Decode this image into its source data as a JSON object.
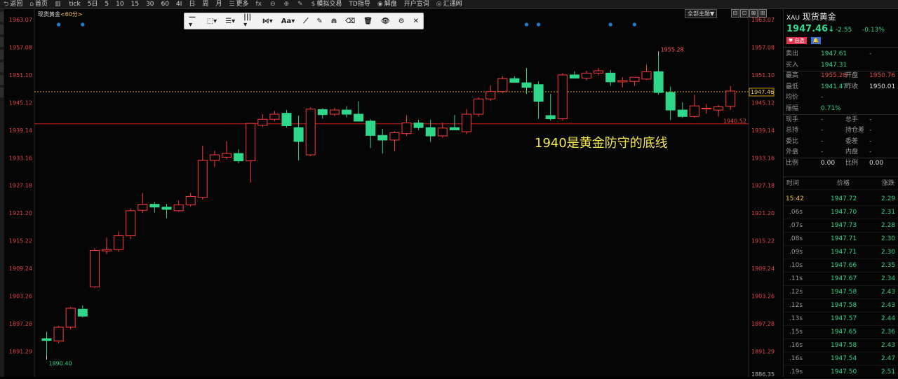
{
  "topbar": {
    "items": [
      {
        "icon": "back-icon",
        "glyph": "⮌",
        "label": "返回"
      },
      {
        "icon": "home-icon",
        "glyph": "⌂",
        "label": "首页"
      },
      {
        "icon": "chart-icon",
        "glyph": "▥",
        "label": ""
      },
      {
        "icon": "",
        "glyph": "",
        "label": "tick"
      },
      {
        "icon": "",
        "glyph": "",
        "label": "5日"
      },
      {
        "icon": "",
        "glyph": "",
        "label": "5"
      },
      {
        "icon": "",
        "glyph": "",
        "label": "10"
      },
      {
        "icon": "",
        "glyph": "",
        "label": "15"
      },
      {
        "icon": "",
        "glyph": "",
        "label": "30"
      },
      {
        "icon": "",
        "glyph": "",
        "label": "60"
      },
      {
        "icon": "",
        "glyph": "",
        "label": "4I"
      },
      {
        "icon": "",
        "glyph": "",
        "label": "日"
      },
      {
        "icon": "",
        "glyph": "",
        "label": "周"
      },
      {
        "icon": "",
        "glyph": "",
        "label": "月"
      },
      {
        "icon": "more-icon",
        "glyph": "☰",
        "label": "更多"
      },
      {
        "icon": "fx-icon",
        "glyph": "fx",
        "label": ""
      },
      {
        "icon": "zoom-out-icon",
        "glyph": "⊖",
        "label": ""
      },
      {
        "icon": "zoom-in-icon",
        "glyph": "⊕",
        "label": ""
      },
      {
        "icon": "pen-icon",
        "glyph": "✎",
        "label": ""
      },
      {
        "icon": "dollar-icon",
        "glyph": "$",
        "label": "模拟交易"
      },
      {
        "icon": "",
        "glyph": "",
        "label": "TD指导"
      },
      {
        "icon": "disk-icon",
        "glyph": "◉",
        "label": "解盘"
      },
      {
        "icon": "",
        "glyph": "",
        "label": "开户宣词"
      },
      {
        "icon": "globe-icon",
        "glyph": "◎",
        "label": "汇通网"
      }
    ]
  },
  "chart_header": {
    "name": "现货黄金",
    "period": "<60分>"
  },
  "chart_toolbar": {
    "items": [
      "—▾",
      "⬚▾",
      "☰▾",
      "|||▾",
      "⋈▾",
      "Aa▾",
      "⟋",
      "✎",
      "⋒",
      "⌫",
      "🗑",
      "👁",
      "⚙",
      "✕"
    ]
  },
  "theme_button": "全部主题▼",
  "window_buttons": [
    "⊟",
    "⊡",
    "⊠",
    "⊞"
  ],
  "annotation": "1940是黄金防守的底线",
  "colors": {
    "up": "#ff3b3b",
    "down": "#2fd78a",
    "axis_text": "#e04848",
    "support_line": "#d02020",
    "current_line": "#d0a000",
    "event_dot": "#1f7fd0",
    "background": "#050505"
  },
  "chart_data": {
    "type": "candlestick",
    "title": "现货黄金 <60分>",
    "ylim": [
      1886.35,
      1963.07
    ],
    "yticks": [
      1963.07,
      1957.08,
      1951.1,
      1945.12,
      1939.14,
      1933.16,
      1927.18,
      1921.2,
      1915.22,
      1909.24,
      1903.26,
      1897.28,
      1891.29
    ],
    "ytick_labels": [
      "1963.07",
      "1957.08",
      "1951.10",
      "1945.12",
      "1939.14",
      "1933.16",
      "1927.18",
      "1921.20",
      "1915.22",
      "1909.24",
      "1903.26",
      "1897.28",
      "1891.29"
    ],
    "ymin_label": "1886.35",
    "high_marker": {
      "label": "1955.28",
      "value": 1955.28,
      "index": 51
    },
    "low_marker": {
      "label": "1890.40",
      "value": 1890.4,
      "index": 0
    },
    "current_price": {
      "label": "1947.46",
      "value": 1947.46
    },
    "support_line": {
      "label": "1940.52",
      "value": 1940.52
    },
    "event_dots": [
      1,
      3,
      40,
      41,
      47,
      49
    ],
    "candles": [
      [
        1894.0,
        1895.5,
        1890.4,
        1893.6
      ],
      [
        1893.5,
        1896.8,
        1893.0,
        1896.5
      ],
      [
        1896.5,
        1900.9,
        1896.0,
        1900.6
      ],
      [
        1900.4,
        1901.2,
        1898.6,
        1898.9
      ],
      [
        1905.2,
        1913.6,
        1905.0,
        1913.1
      ],
      [
        1913.0,
        1915.9,
        1912.3,
        1913.3
      ],
      [
        1913.3,
        1917.2,
        1912.8,
        1916.3
      ],
      [
        1916.3,
        1922.2,
        1915.6,
        1921.7
      ],
      [
        1921.8,
        1925.6,
        1921.2,
        1923.1
      ],
      [
        1923.1,
        1923.6,
        1921.3,
        1922.5
      ],
      [
        1922.5,
        1923.2,
        1920.1,
        1922.0
      ],
      [
        1921.7,
        1923.9,
        1921.5,
        1923.0
      ],
      [
        1923.0,
        1925.6,
        1922.6,
        1924.8
      ],
      [
        1924.6,
        1935.8,
        1924.1,
        1932.6
      ],
      [
        1932.6,
        1934.7,
        1931.2,
        1933.8
      ],
      [
        1933.3,
        1936.8,
        1932.8,
        1934.1
      ],
      [
        1934.1,
        1935.0,
        1932.0,
        1932.5
      ],
      [
        1932.5,
        1940.7,
        1927.8,
        1940.6
      ],
      [
        1940.2,
        1942.6,
        1939.8,
        1941.5
      ],
      [
        1941.5,
        1943.3,
        1941.1,
        1942.6
      ],
      [
        1942.8,
        1943.5,
        1939.7,
        1940.1
      ],
      [
        1939.7,
        1942.3,
        1932.6,
        1936.7
      ],
      [
        1933.8,
        1944.1,
        1933.5,
        1943.7
      ],
      [
        1943.6,
        1943.9,
        1941.6,
        1942.5
      ],
      [
        1942.6,
        1944.0,
        1942.2,
        1943.5
      ],
      [
        1943.5,
        1944.3,
        1941.9,
        1942.6
      ],
      [
        1942.6,
        1945.4,
        1941.6,
        1941.1
      ],
      [
        1941.1,
        1941.5,
        1935.3,
        1938.0
      ],
      [
        1938.0,
        1939.4,
        1934.1,
        1937.0
      ],
      [
        1937.0,
        1938.9,
        1934.6,
        1938.6
      ],
      [
        1938.4,
        1942.4,
        1938.0,
        1940.7
      ],
      [
        1940.7,
        1941.4,
        1939.2,
        1939.7
      ],
      [
        1939.7,
        1941.4,
        1936.6,
        1937.9
      ],
      [
        1937.9,
        1940.8,
        1937.5,
        1939.6
      ],
      [
        1939.7,
        1942.4,
        1939.2,
        1939.2
      ],
      [
        1938.8,
        1943.7,
        1938.3,
        1942.6
      ],
      [
        1942.6,
        1946.3,
        1942.1,
        1945.9
      ],
      [
        1945.9,
        1948.8,
        1945.5,
        1947.5
      ],
      [
        1947.5,
        1950.8,
        1947.1,
        1950.3
      ],
      [
        1950.3,
        1950.8,
        1949.4,
        1949.5
      ],
      [
        1949.4,
        1952.6,
        1947.0,
        1948.4
      ],
      [
        1949.0,
        1949.7,
        1941.6,
        1945.4
      ],
      [
        1942.3,
        1947.0,
        1941.2,
        1941.6
      ],
      [
        1941.6,
        1951.5,
        1941.2,
        1951.1
      ],
      [
        1951.1,
        1951.9,
        1950.4,
        1950.4
      ],
      [
        1950.4,
        1952.0,
        1949.9,
        1951.5
      ],
      [
        1951.5,
        1952.6,
        1951.0,
        1952.0
      ],
      [
        1951.5,
        1952.2,
        1948.7,
        1949.6
      ],
      [
        1949.6,
        1950.6,
        1948.4,
        1949.9
      ],
      [
        1949.7,
        1950.6,
        1948.7,
        1950.6
      ],
      [
        1950.2,
        1953.3,
        1950.0,
        1951.8
      ],
      [
        1951.8,
        1955.3,
        1946.8,
        1947.3
      ],
      [
        1947.3,
        1948.6,
        1941.3,
        1943.5
      ],
      [
        1943.5,
        1945.2,
        1941.8,
        1942.1
      ],
      [
        1942.1,
        1946.8,
        1941.8,
        1944.4
      ],
      [
        1943.9,
        1944.8,
        1942.7,
        1943.9
      ],
      [
        1943.5,
        1944.6,
        1942.1,
        1944.2
      ],
      [
        1944.3,
        1948.7,
        1943.5,
        1947.6
      ]
    ]
  },
  "quote_panel": {
    "symbol": "XAU",
    "name": "现货黄金",
    "price": "1947.46",
    "arrow": "↓",
    "change": "-2.55",
    "change_pct": "-0.13%",
    "badge_watch": "♥ 自选",
    "badge_alert": "🔔",
    "rows": [
      {
        "l1": "卖出",
        "v1": "1947.61",
        "c1": "green",
        "l2": "",
        "v2": "-",
        "c2": "grey"
      },
      {
        "l1": "买入",
        "v1": "1947.31",
        "c1": "green",
        "l2": "",
        "v2": "",
        "c2": "grey"
      },
      {
        "l1": "最高",
        "v1": "1955.28",
        "c1": "red",
        "l2": "开盘",
        "v2": "1950.76",
        "c2": "red"
      },
      {
        "l1": "最低",
        "v1": "1941.47",
        "c1": "green",
        "l2": "昨收",
        "v2": "1950.01",
        "c2": "white"
      },
      {
        "l1": "均价",
        "v1": "-",
        "c1": "grey",
        "l2": "",
        "v2": "",
        "c2": "grey"
      },
      {
        "l1": "振幅",
        "v1": "0.71%",
        "c1": "green",
        "l2": "",
        "v2": "",
        "c2": "grey"
      },
      {
        "l1": "现手",
        "v1": "-",
        "c1": "grey",
        "l2": "总手",
        "v2": "-",
        "c2": "grey"
      },
      {
        "l1": "总持",
        "v1": "-",
        "c1": "grey",
        "l2": "持仓差",
        "v2": "-",
        "c2": "grey"
      },
      {
        "l1": "委比",
        "v1": "-",
        "c1": "grey",
        "l2": "委差",
        "v2": "-",
        "c2": "grey"
      },
      {
        "l1": "外盘",
        "v1": "-",
        "c1": "grey",
        "l2": "内盘",
        "v2": "-",
        "c2": "grey"
      },
      {
        "l1": "比例",
        "v1": "0.00",
        "c1": "white",
        "l2": "比例",
        "v2": "0.00",
        "c2": "white"
      }
    ],
    "trade_headers": [
      "时间",
      "价格",
      "涨跌"
    ],
    "trades": [
      {
        "time": "15:42",
        "price": "1947.72",
        "chg": "2.29"
      },
      {
        "time": ".06s",
        "price": "1947.70",
        "chg": "2.31"
      },
      {
        "time": ".07s",
        "price": "1947.73",
        "chg": "2.28"
      },
      {
        "time": ".08s",
        "price": "1947.71",
        "chg": "2.30"
      },
      {
        "time": ".09s",
        "price": "1947.71",
        "chg": "2.30"
      },
      {
        "time": ".10s",
        "price": "1947.66",
        "chg": "2.35"
      },
      {
        "time": ".11s",
        "price": "1947.67",
        "chg": "2.34"
      },
      {
        "time": ".12s",
        "price": "1947.58",
        "chg": "2.43"
      },
      {
        "time": ".12s",
        "price": "1947.58",
        "chg": "2.43"
      },
      {
        "time": ".13s",
        "price": "1947.57",
        "chg": "2.44"
      },
      {
        "time": ".15s",
        "price": "1947.65",
        "chg": "2.36"
      },
      {
        "time": ".16s",
        "price": "1947.58",
        "chg": "2.43"
      },
      {
        "time": ".16s",
        "price": "1947.54",
        "chg": "2.47"
      },
      {
        "time": ".19s",
        "price": "1947.50",
        "chg": "2.51"
      }
    ]
  }
}
